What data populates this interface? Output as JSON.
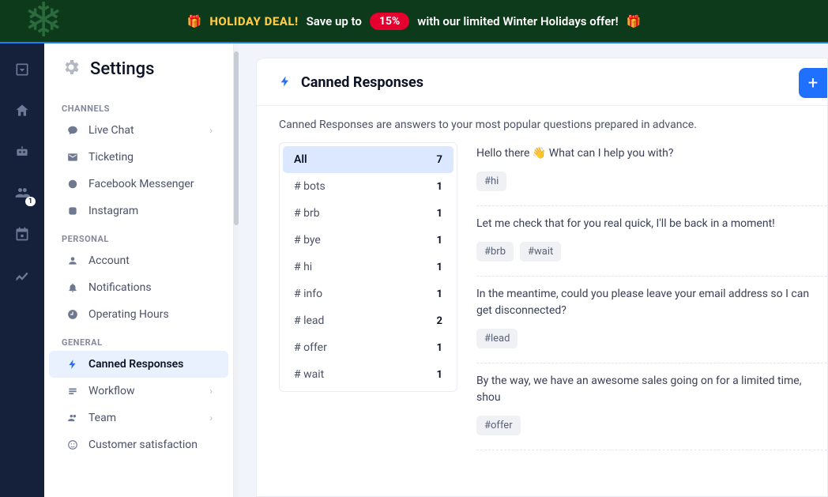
{
  "banner": {
    "deal": "HOLIDAY DEAL!",
    "prefix": "Save up to",
    "pill": "15%",
    "suffix": "with our limited Winter Holidays offer!",
    "gift": "🎁"
  },
  "rail": {
    "badge_count": "1"
  },
  "sidebar": {
    "title": "Settings",
    "sections": {
      "channels": {
        "label": "CHANNELS",
        "items": [
          {
            "label": "Live Chat",
            "icon": "chat",
            "chev": true
          },
          {
            "label": "Ticketing",
            "icon": "mail"
          },
          {
            "label": "Facebook Messenger",
            "icon": "messenger"
          },
          {
            "label": "Instagram",
            "icon": "instagram"
          }
        ]
      },
      "personal": {
        "label": "PERSONAL",
        "items": [
          {
            "label": "Account",
            "icon": "account"
          },
          {
            "label": "Notifications",
            "icon": "bell"
          },
          {
            "label": "Operating Hours",
            "icon": "clock"
          }
        ]
      },
      "general": {
        "label": "GENERAL",
        "items": [
          {
            "label": "Canned Responses",
            "icon": "bolt",
            "active": true
          },
          {
            "label": "Workflow",
            "icon": "workflow",
            "chev": true
          },
          {
            "label": "Team",
            "icon": "team",
            "chev": true
          },
          {
            "label": "Customer satisfaction",
            "icon": "smile"
          }
        ]
      }
    }
  },
  "panel": {
    "title": "Canned Responses",
    "desc": "Canned Responses are answers to your most popular questions prepared in advance.",
    "add": "+",
    "tags": [
      {
        "label": "All",
        "count": "7",
        "active": true
      },
      {
        "label": "# bots",
        "count": "1"
      },
      {
        "label": "# brb",
        "count": "1"
      },
      {
        "label": "# bye",
        "count": "1"
      },
      {
        "label": "# hi",
        "count": "1"
      },
      {
        "label": "# info",
        "count": "1"
      },
      {
        "label": "# lead",
        "count": "2"
      },
      {
        "label": "# offer",
        "count": "1"
      },
      {
        "label": "# wait",
        "count": "1"
      }
    ],
    "responses": [
      {
        "text": "Hello there 👋 What can I help you with?",
        "tags": [
          "#hi"
        ]
      },
      {
        "text": "Let me check that for you real quick, I'll be back in a moment!",
        "tags": [
          "#brb",
          "#wait"
        ]
      },
      {
        "text": "In the meantime, could you please leave your email address so I can get disconnected?",
        "tags": [
          "#lead"
        ]
      },
      {
        "text": "By the way, we have an awesome sales going on for a limited time, shou",
        "tags": [
          "#offer"
        ]
      }
    ]
  }
}
